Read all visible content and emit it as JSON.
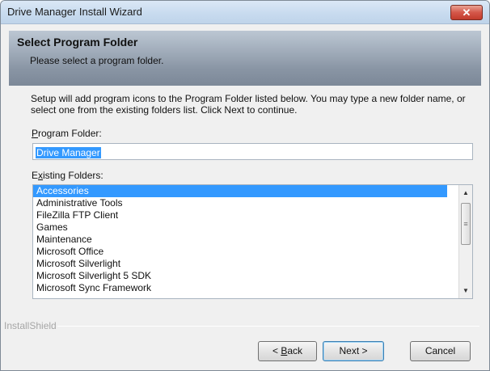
{
  "window": {
    "title": "Drive Manager Install Wizard",
    "close_glyph": "✕"
  },
  "header": {
    "title": "Select Program Folder",
    "subtitle": "Please select a program folder."
  },
  "body": {
    "description": "Setup will add program icons to the Program Folder listed below.  You may type a new folder name, or select one from the existing folders list.  Click Next to continue.",
    "program_folder_label_accel": "P",
    "program_folder_label_rest": "rogram Folder:",
    "program_folder_value": "Drive Manager",
    "existing_folders_label_pre": "E",
    "existing_folders_label_accel": "x",
    "existing_folders_label_rest": "isting Folders:",
    "folders": [
      "Accessories",
      "Administrative Tools",
      "FileZilla FTP Client",
      "Games",
      "Maintenance",
      "Microsoft Office",
      "Microsoft Silverlight",
      "Microsoft Silverlight 5 SDK",
      "Microsoft Sync Framework"
    ],
    "selected_folder": "Accessories"
  },
  "footer": {
    "brand": "InstallShield",
    "back_pre": "< ",
    "back_accel": "B",
    "back_rest": "ack",
    "next_label": "Next >",
    "cancel_label": "Cancel"
  },
  "colors": {
    "selection": "#3399ff",
    "close_button": "#c23b2c"
  }
}
